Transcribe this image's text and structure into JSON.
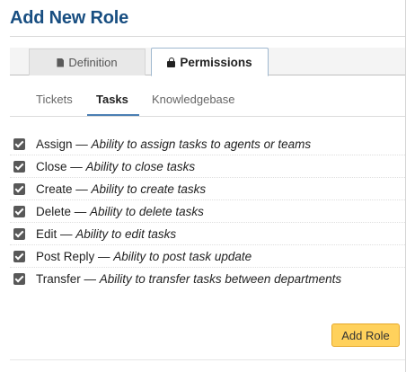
{
  "dialog": {
    "title": "Add New Role"
  },
  "tabs": [
    {
      "label": "Definition",
      "icon": "document-icon"
    },
    {
      "label": "Permissions",
      "icon": "lock-icon"
    }
  ],
  "subtabs": [
    {
      "label": "Tickets"
    },
    {
      "label": "Tasks"
    },
    {
      "label": "Knowledgebase"
    }
  ],
  "separator": " — ",
  "permissions": [
    {
      "name": "Assign",
      "desc": "Ability to assign tasks to agents or teams",
      "checked": true
    },
    {
      "name": "Close",
      "desc": "Ability to close tasks",
      "checked": true
    },
    {
      "name": "Create",
      "desc": "Ability to create tasks",
      "checked": true
    },
    {
      "name": "Delete",
      "desc": "Ability to delete tasks",
      "checked": true
    },
    {
      "name": "Edit",
      "desc": "Ability to edit tasks",
      "checked": true
    },
    {
      "name": "Post Reply",
      "desc": "Ability to post task update",
      "checked": true
    },
    {
      "name": "Transfer",
      "desc": "Ability to transfer tasks between departments",
      "checked": true
    }
  ],
  "footer": {
    "submit_label": "Add Role"
  },
  "colors": {
    "title": "#184e81",
    "accent_button": "#ffd15c",
    "active_underline": "#4b7fb3"
  }
}
